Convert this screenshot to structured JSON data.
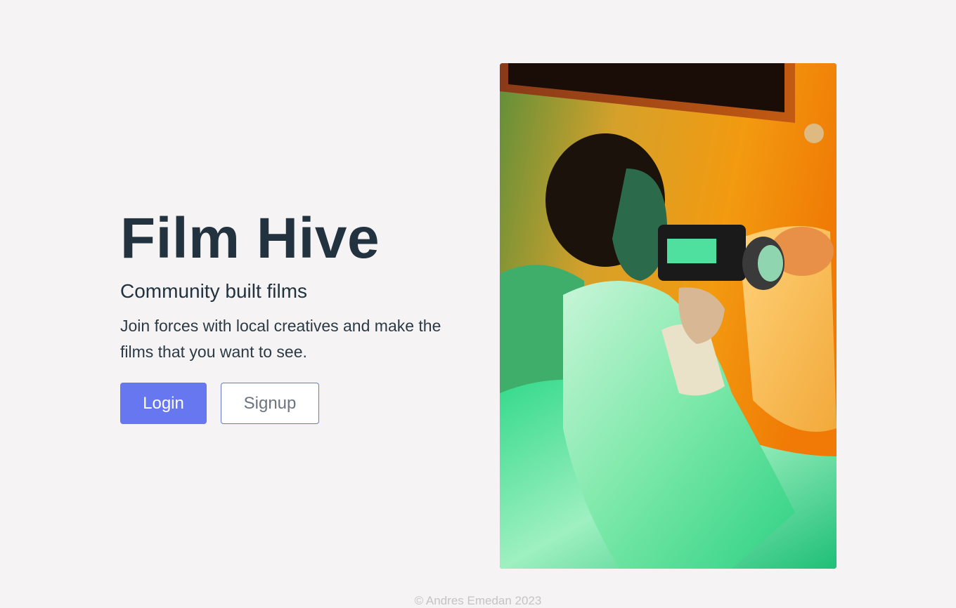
{
  "hero": {
    "title": "Film Hive",
    "subtitle": "Community built films",
    "description": "Join forces with local creatives and make the films that you want to see.",
    "login_label": "Login",
    "signup_label": "Signup"
  },
  "footer": {
    "copyright": "© Andres Emedan 2023"
  },
  "colors": {
    "primary": "#6677f0",
    "heading": "#22333f",
    "background": "#f5f3f4"
  },
  "icons": {
    "hero_image": "person-with-film-camera-photo"
  }
}
